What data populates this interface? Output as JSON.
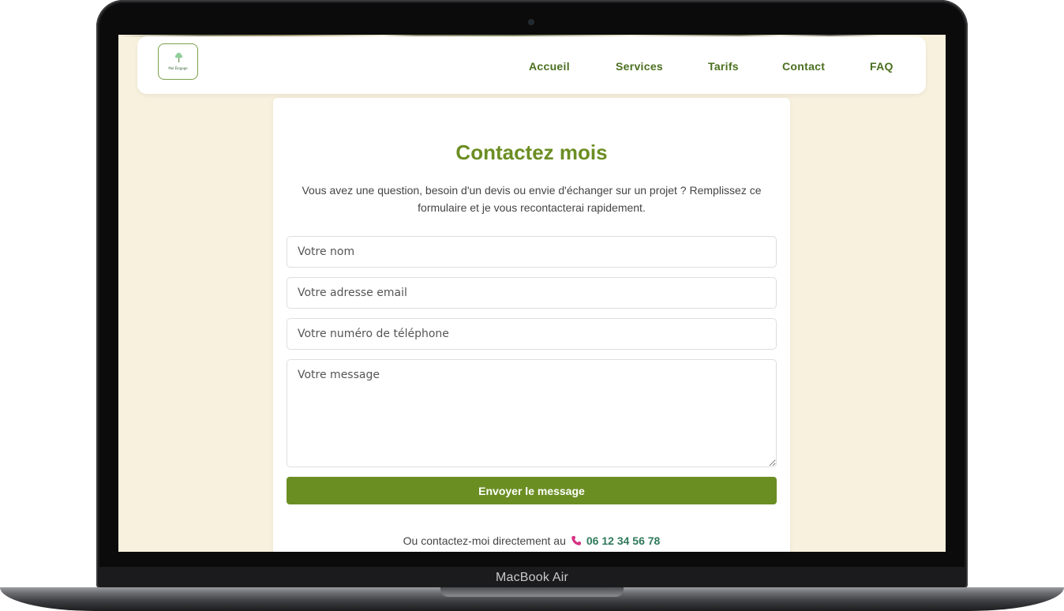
{
  "device": {
    "label": "MacBook Air"
  },
  "header": {
    "logo_text": "Mel Élagage",
    "nav": [
      {
        "label": "Accueil"
      },
      {
        "label": "Services"
      },
      {
        "label": "Tarifs"
      },
      {
        "label": "Contact"
      },
      {
        "label": "FAQ"
      }
    ]
  },
  "contact": {
    "title": "Contactez mois",
    "intro": "Vous avez une question, besoin d'un devis ou envie d'échanger sur un projet ? Remplissez ce formulaire et je vous recontacterai rapidement.",
    "fields": {
      "name_placeholder": "Votre nom",
      "email_placeholder": "Votre adresse email",
      "phone_placeholder": "Votre numéro de téléphone",
      "message_placeholder": "Votre message"
    },
    "submit_label": "Envoyer le message",
    "direct_text": "Ou contactez-moi directement au",
    "phone_number": "06 12 34 56 78",
    "phone_icon": "phone-icon"
  },
  "colors": {
    "accent": "#6b8e23",
    "nav_text": "#4a6f1f",
    "page_bg": "#f8f1de",
    "phone_number": "#2f7a5a",
    "phone_icon": "#d63384"
  }
}
